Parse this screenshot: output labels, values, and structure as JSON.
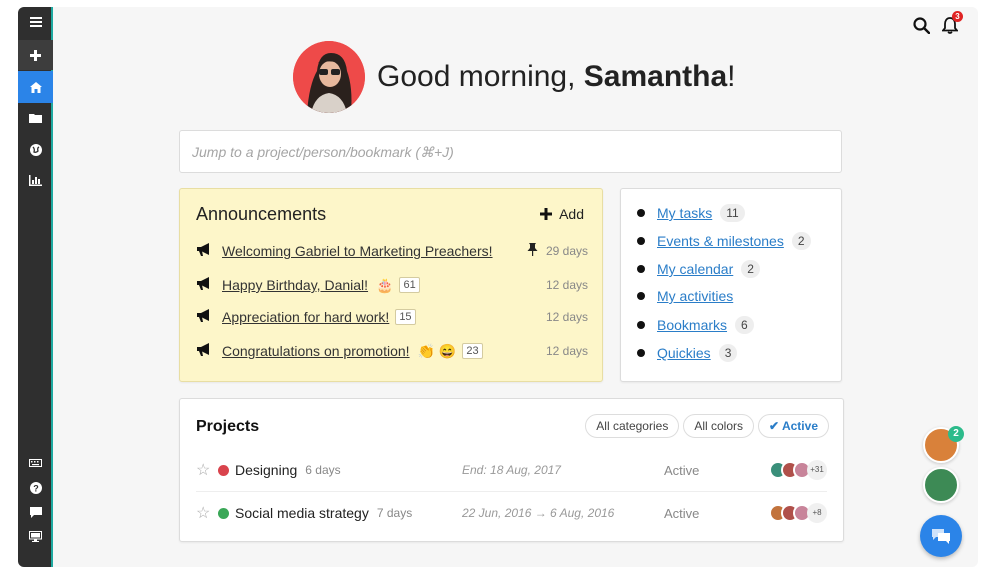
{
  "sidebar": {
    "items": [
      {
        "name": "menu-icon",
        "active": false
      },
      {
        "name": "plus-icon",
        "active": false
      },
      {
        "name": "home-icon",
        "active": true
      },
      {
        "name": "folder-icon",
        "active": false
      },
      {
        "name": "globe-icon",
        "active": false
      },
      {
        "name": "bar-chart-icon",
        "active": false
      }
    ],
    "bottom_items": [
      {
        "name": "keyboard-icon"
      },
      {
        "name": "help-icon"
      },
      {
        "name": "chat-icon"
      },
      {
        "name": "monitor-icon"
      }
    ],
    "accent_color": "#1fa9a0",
    "active_color": "#2b84e8"
  },
  "topbar": {
    "search_icon": "search-icon",
    "bell_icon": "bell-icon",
    "notification_count": "3"
  },
  "greeting": {
    "prefix": "Good morning, ",
    "name": "Samantha",
    "suffix": "!"
  },
  "search": {
    "placeholder": "Jump to a project/person/bookmark (⌘+J)"
  },
  "announcements": {
    "title": "Announcements",
    "add_label": "Add",
    "items": [
      {
        "text": "Welcoming Gabriel to Marketing Preachers!",
        "emoji": "",
        "count": "",
        "days": "29 days",
        "pinned": true
      },
      {
        "text": "Happy Birthday, Danial!",
        "emoji": "🎂",
        "count": "61",
        "days": "12 days",
        "pinned": false
      },
      {
        "text": "Appreciation for hard work!",
        "emoji": "",
        "count": "15",
        "days": "12 days",
        "pinned": false
      },
      {
        "text": "Congratulations on promotion!",
        "emoji": "👏 😄",
        "count": "23",
        "days": "12 days",
        "pinned": false
      }
    ]
  },
  "quick_links": [
    {
      "label": "My tasks",
      "count": "11"
    },
    {
      "label": "Events & milestones",
      "count": "2"
    },
    {
      "label": "My calendar",
      "count": "2"
    },
    {
      "label": "My activities",
      "count": ""
    },
    {
      "label": "Bookmarks",
      "count": "6"
    },
    {
      "label": "Quickies",
      "count": "3"
    }
  ],
  "projects": {
    "title": "Projects",
    "filters": [
      "All categories",
      "All colors",
      "Active"
    ],
    "active_filter": "Active",
    "rows": [
      {
        "name": "Designing",
        "days": "6 days",
        "date": "End: 18 Aug, 2017",
        "status": "Active",
        "color": "#d9434c",
        "more": "+31"
      },
      {
        "name": "Social media strategy",
        "days": "7 days",
        "date": "22 Jun, 2016 → 6 Aug, 2016",
        "status": "Active",
        "color": "#3aa757",
        "more": "+8"
      }
    ]
  },
  "floating": {
    "badge": "2"
  }
}
